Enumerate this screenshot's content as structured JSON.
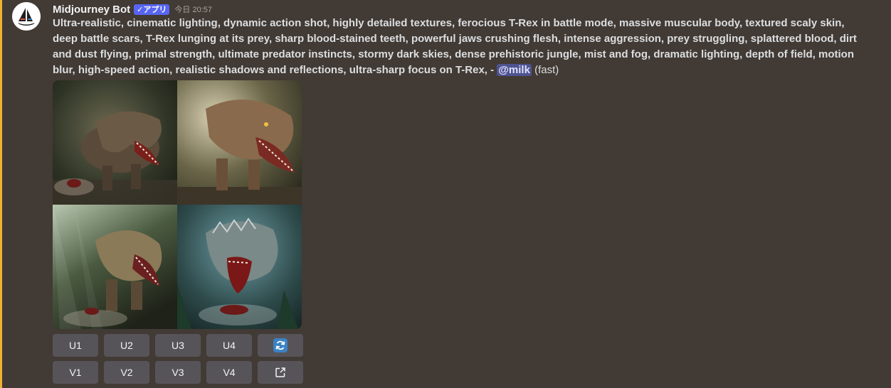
{
  "message": {
    "author": "Midjourney Bot",
    "badge": "✓アプリ",
    "timestamp": "今日 20:57",
    "prompt": "Ultra-realistic, cinematic lighting, dynamic action shot, highly detailed textures, ferocious T-Rex in battle mode, massive muscular body, textured scaly skin, deep battle scars, T-Rex lunging at its prey, sharp blood-stained teeth, powerful jaws crushing flesh, intense aggression, prey struggling, splattered blood, dirt and dust flying, primal strength, ultimate predator instincts, stormy dark skies, dense prehistoric jungle, mist and fog, dramatic lighting, depth of field, motion blur, high-speed action, realistic shadows and reflections, ultra-sharp focus on T-Rex, - ",
    "mention": "@milk",
    "speed": " (fast)"
  },
  "buttons": {
    "row1": [
      "U1",
      "U2",
      "U3",
      "U4"
    ],
    "row2": [
      "V1",
      "V2",
      "V3",
      "V4"
    ],
    "reroll_icon": "refresh-icon",
    "open_icon": "external-link-icon"
  },
  "colors": {
    "background": "#423a34",
    "mention_bar": "#f0b232",
    "badge": "#5865f2",
    "button": "#575459",
    "reroll_accent": "#3b82c4"
  }
}
